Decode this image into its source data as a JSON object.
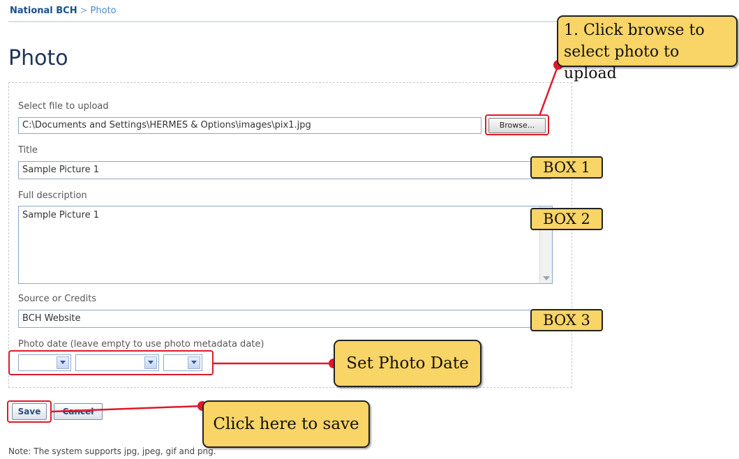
{
  "breadcrumb": {
    "home": "National BCH",
    "separator": ">",
    "current": "Photo"
  },
  "page": {
    "title": "Photo"
  },
  "form": {
    "file": {
      "label": "Select file to upload",
      "value": "C:\\Documents and Settings\\HERMES & Options\\images\\pix1.jpg",
      "browse_label": "Browse..."
    },
    "title": {
      "label": "Title",
      "value": "Sample Picture 1"
    },
    "description": {
      "label": "Full description",
      "value": "Sample Picture 1"
    },
    "source": {
      "label": "Source or Credits",
      "value": "BCH Website"
    },
    "photo_date": {
      "label": "Photo date (leave empty to use photo metadata date)",
      "day": "",
      "month": "",
      "year": ""
    },
    "save_label": "Save",
    "cancel_label": "Cancel"
  },
  "note": "Note: The system supports jpg, jpeg, gif and png.",
  "annotations": {
    "browse_callout_line1": "1. Click browse to",
    "browse_callout_line2": "select photo to upload",
    "box1": "BOX 1",
    "box2": "BOX 2",
    "box3": "BOX 3",
    "date_callout": "Set Photo Date",
    "save_callout": "Click here to save"
  },
  "colors": {
    "annotation_red": "#e0182a",
    "callout_yellow": "#f9d466",
    "field_border": "#8fa7c7",
    "title_blue": "#1d3557"
  }
}
